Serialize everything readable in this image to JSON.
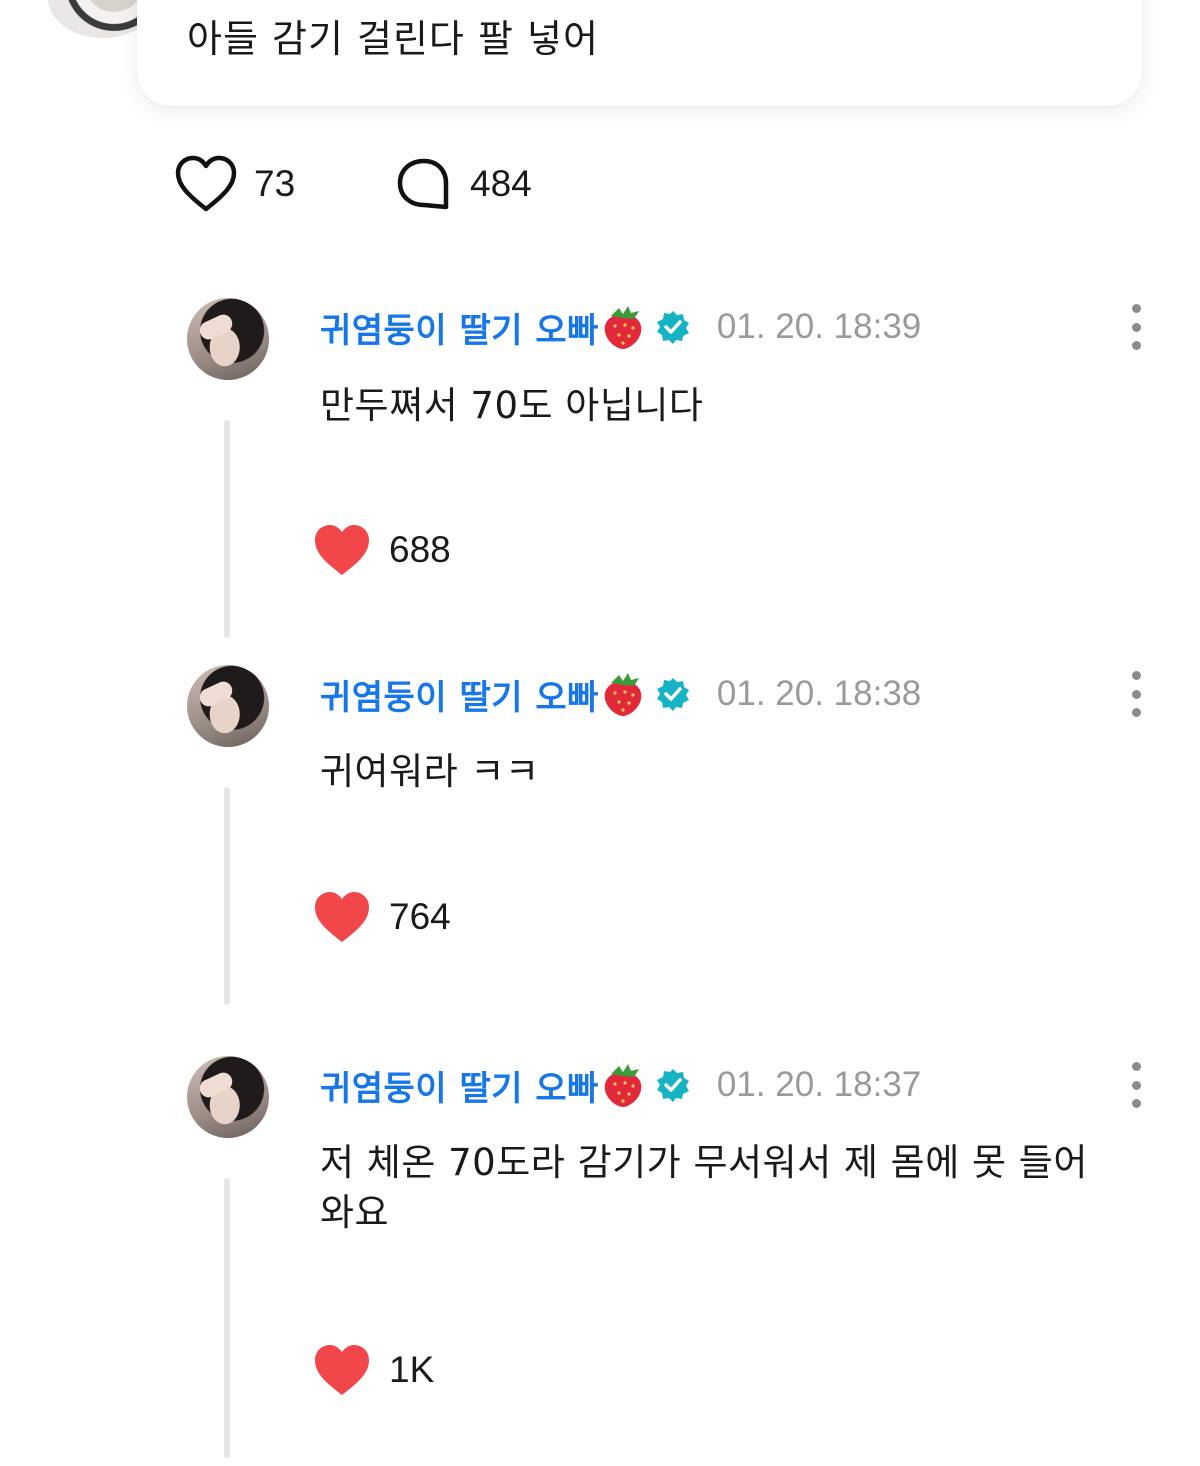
{
  "post": {
    "text": "아들 감기 걸린다 팔 넣어",
    "like_count": "73",
    "reply_count": "484"
  },
  "colors": {
    "author": "#1877e8",
    "heart_filled": "#f2474a",
    "verified": "#16b3c5",
    "timestamp": "#9a9a9a",
    "thread_line": "#e6e6e8"
  },
  "icons": {
    "like_outline": "heart-outline-icon",
    "reply": "speech-bubble-icon",
    "like_filled": "heart-filled-icon",
    "verified": "verified-badge-icon",
    "emoji": "strawberry-icon",
    "more": "more-vertical-icon"
  },
  "replies": [
    {
      "author": "귀염둥이 딸기 오빠",
      "timestamp": "01. 20. 18:39",
      "text": "만두쪄서 70도 아닙니다",
      "likes": "688"
    },
    {
      "author": "귀염둥이 딸기 오빠",
      "timestamp": "01. 20. 18:38",
      "text": "귀여워라 ㅋㅋ",
      "likes": "764"
    },
    {
      "author": "귀염둥이 딸기 오빠",
      "timestamp": "01. 20. 18:37",
      "text": "저 체온 70도라 감기가 무서워서 제 몸에 못 들어와요",
      "likes": "1K"
    }
  ]
}
